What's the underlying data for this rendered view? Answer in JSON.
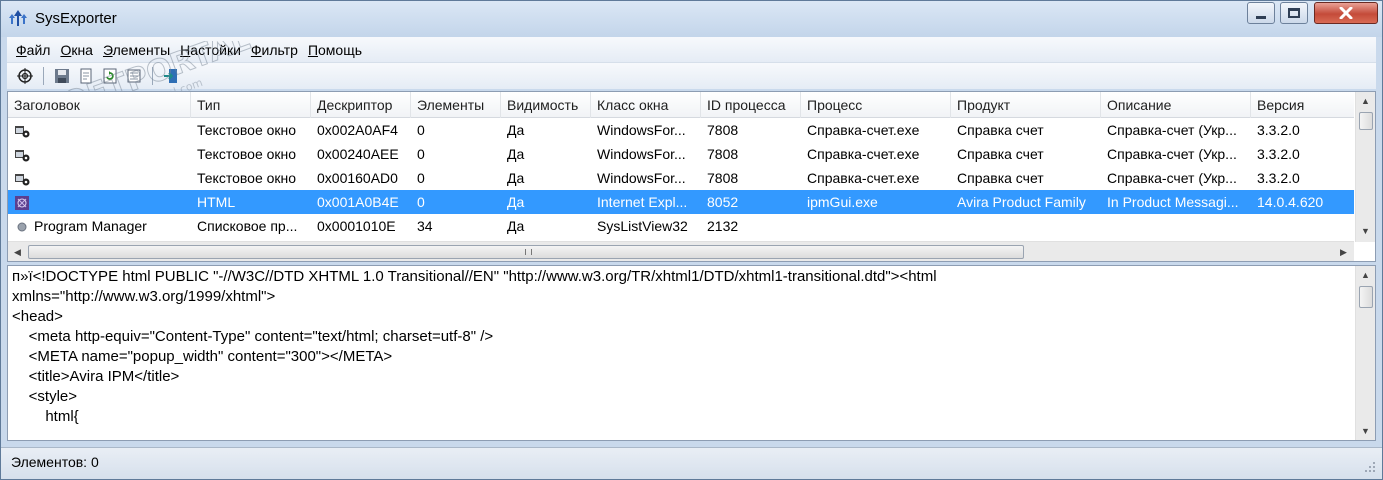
{
  "window": {
    "title": "SysExporter"
  },
  "menu": [
    {
      "pre": "",
      "u": "Ф",
      "post": "айл"
    },
    {
      "pre": "",
      "u": "О",
      "post": "кна"
    },
    {
      "pre": "",
      "u": "Э",
      "post": "лементы"
    },
    {
      "pre": "",
      "u": "Н",
      "post": "астойки"
    },
    {
      "pre": "",
      "u": "Ф",
      "post": "ильтр"
    },
    {
      "pre": "",
      "u": "П",
      "post": "омощь"
    }
  ],
  "toolbar": {
    "buttons": [
      "target-icon",
      "save-icon",
      "copy-icon",
      "refresh-icon",
      "properties-icon",
      "exit-icon"
    ]
  },
  "watermark": {
    "brand": "SOFTPORTAL",
    "trademark": "TM",
    "url": "www.softportal.com"
  },
  "list": {
    "columns": [
      "Заголовок",
      "Тип",
      "Дескриптор",
      "Элементы",
      "Видимость",
      "Класс окна",
      "ID процесса",
      "Процесс",
      "Продукт",
      "Описание",
      "Версия"
    ],
    "rows": [
      [
        "",
        "Текстовое окно",
        "0x002A0AF4",
        "0",
        "Да",
        "WindowsFor...",
        "7808",
        "Справка-счет.exe",
        "Справка счет",
        "Справка-счет (Укр...",
        "3.3.2.0"
      ],
      [
        "",
        "Текстовое окно",
        "0x00240AEE",
        "0",
        "Да",
        "WindowsFor...",
        "7808",
        "Справка-счет.exe",
        "Справка счет",
        "Справка-счет (Укр...",
        "3.3.2.0"
      ],
      [
        "",
        "Текстовое окно",
        "0x00160AD0",
        "0",
        "Да",
        "WindowsFor...",
        "7808",
        "Справка-счет.exe",
        "Справка счет",
        "Справка-счет (Укр...",
        "3.3.2.0"
      ],
      [
        "",
        "HTML",
        "0x001A0B4E",
        "0",
        "Да",
        "Internet Expl...",
        "8052",
        "ipmGui.exe",
        "Avira Product Family",
        "In Product Messagi...",
        "14.0.4.620"
      ],
      [
        "Program Manager",
        "Списковое пр...",
        "0x0001010E",
        "34",
        "Да",
        "SysListView32",
        "2132",
        "",
        "",
        "",
        ""
      ]
    ],
    "row_icons": [
      "text-window-icon",
      "text-window-icon",
      "text-window-icon",
      "html-window-icon",
      "gray-dot-icon"
    ],
    "selected_row": 3
  },
  "text_content": [
    "п»ї<!DOCTYPE html PUBLIC \"-//W3C//DTD XHTML 1.0 Transitional//EN\" \"http://www.w3.org/TR/xhtml1/DTD/xhtml1-transitional.dtd\"><html",
    "xmlns=\"http://www.w3.org/1999/xhtml\">",
    "<head>",
    "    <meta http-equiv=\"Content-Type\" content=\"text/html; charset=utf-8\" />",
    "    <META name=\"popup_width\" content=\"300\"></META>",
    "    <title>Avira IPM</title>",
    "    <style>",
    "        html{"
  ],
  "status": {
    "text": "Элементов: 0"
  }
}
